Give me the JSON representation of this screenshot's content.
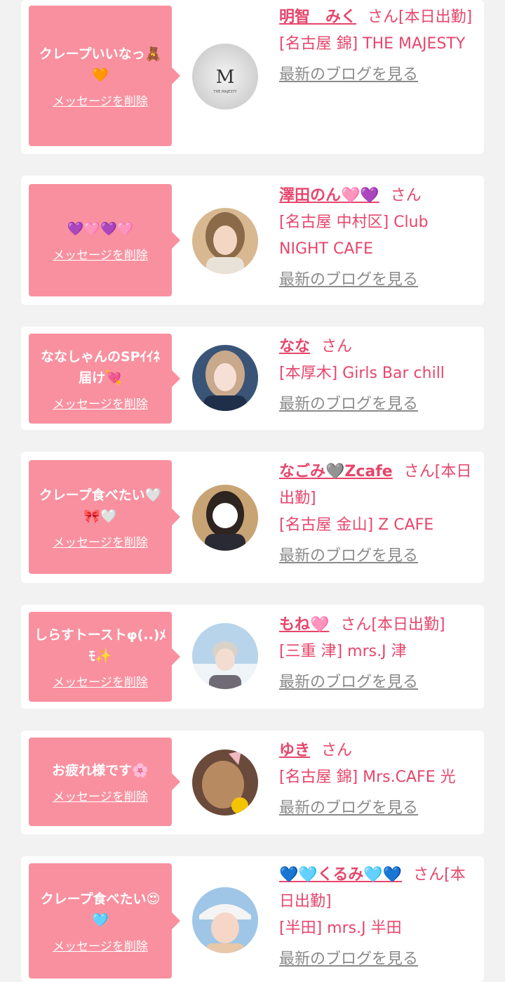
{
  "cards": [
    {
      "message": "クレープいいなっ🧸🧡",
      "delete_label": "メッセージを削除",
      "name": "明智　みく",
      "suffix": "さん[本日出勤]",
      "shop": "[名古屋 錦] THE MAJESTY",
      "blog_label": "最新のブログを見る",
      "avatar": "logo-avatar"
    },
    {
      "message": "💜🩷💜🩷",
      "delete_label": "メッセージを削除",
      "name": "澤田のん🩷💜",
      "suffix": "さん",
      "shop": "[名古屋 中村区] Club NIGHT CAFE",
      "blog_label": "最新のブログを見る",
      "avatar": "profile-photo"
    },
    {
      "message": "ななしゃんのSPｲｲﾈ届け💘",
      "delete_label": "メッセージを削除",
      "name": "なな",
      "suffix": "さん",
      "shop": "[本厚木] Girls Bar chill",
      "blog_label": "最新のブログを見る",
      "avatar": "profile-photo"
    },
    {
      "message": "クレープ食べたい🤍🎀🤍",
      "delete_label": "メッセージを削除",
      "name": "なごみ🩶Zcafe",
      "suffix": "さん[本日出勤]",
      "shop": "[名古屋 金山] Z CAFE",
      "blog_label": "最新のブログを見る",
      "avatar": "profile-photo"
    },
    {
      "message": "しらすトーストφ(..)ﾒﾓ✨",
      "delete_label": "メッセージを削除",
      "name": "もね🩷",
      "suffix": "さん[本日出勤]",
      "shop": "[三重 津] mrs.J 津",
      "blog_label": "最新のブログを見る",
      "avatar": "profile-photo"
    },
    {
      "message": "お疲れ様です🌸",
      "delete_label": "メッセージを削除",
      "name": "ゆき",
      "suffix": "さん",
      "shop": "[名古屋 錦] Mrs.CAFE 光",
      "blog_label": "最新のブログを見る",
      "avatar": "profile-photo"
    },
    {
      "message": "クレープ食べたい😍🩵",
      "delete_label": "メッセージを削除",
      "name": "💙🩵くるみ🩵💙",
      "suffix": "さん[本日出勤]",
      "shop": "[半田] mrs.J 半田",
      "blog_label": "最新のブログを見る",
      "avatar": "profile-photo"
    }
  ]
}
